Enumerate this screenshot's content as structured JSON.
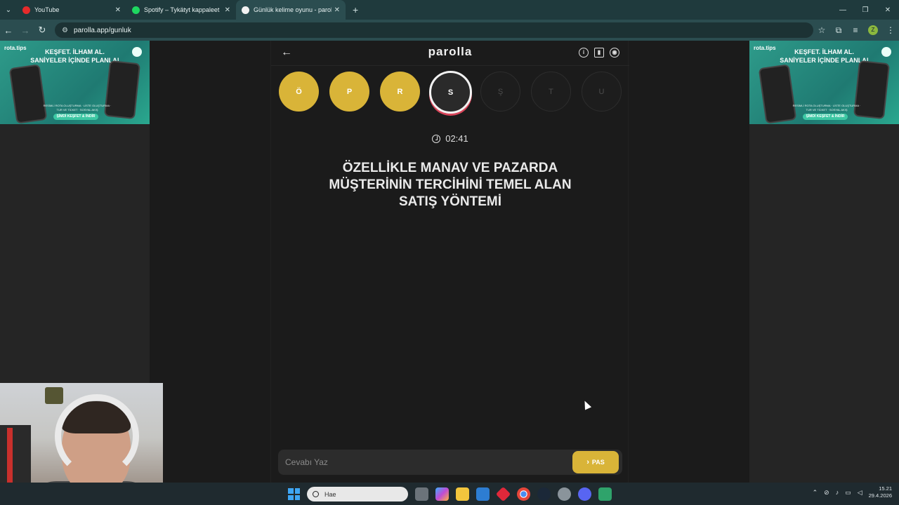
{
  "browser": {
    "tabs": [
      {
        "title": "YouTube",
        "fav_color": "#e62b2b",
        "active": false
      },
      {
        "title": "Spotify – Tykätyt kappaleet",
        "fav_color": "#1ed760",
        "active": false
      },
      {
        "title": "Günlük kelime oyunu - parolla",
        "fav_color": "#f2f2f2",
        "active": true
      }
    ],
    "url": "parolla.app/gunluk",
    "profile_initial": "Z"
  },
  "ads": {
    "brand": "rota.tips",
    "headline_1": "KEŞFET. İLHAM AL.",
    "headline_2": "SANİYELER İÇİNDE PLANLA!",
    "sub": "RESİMLİ ROTA OLUŞTURMA · LİSTE OLUŞTURMA · TUR VE TİCKET · SOSYAL AKIŞ",
    "cta": "ŞİMDİ KEŞFET & İNDİR"
  },
  "game": {
    "logo": "parolla",
    "letters": [
      {
        "char": "Ö",
        "state": "done"
      },
      {
        "char": "P",
        "state": "done"
      },
      {
        "char": "R",
        "state": "done"
      },
      {
        "char": "S",
        "state": "current"
      },
      {
        "char": "Ş",
        "state": "todo"
      },
      {
        "char": "T",
        "state": "todo"
      },
      {
        "char": "U",
        "state": "todo"
      }
    ],
    "timer": "02:41",
    "question_lines": [
      "ÖZELLİKLE MANAV VE PAZARDA",
      "MÜŞTERİNİN TERCİHİNİ TEMEL ALAN",
      "SATIŞ YÖNTEMİ"
    ],
    "answer_placeholder": "Cevabı Yaz",
    "pass_label": "PAS",
    "colors": {
      "done": "#d9b438",
      "current_ring": "#d8455a"
    }
  },
  "taskbar": {
    "search_placeholder": "Hae",
    "time": "15.21",
    "date": "29.4.2026"
  }
}
